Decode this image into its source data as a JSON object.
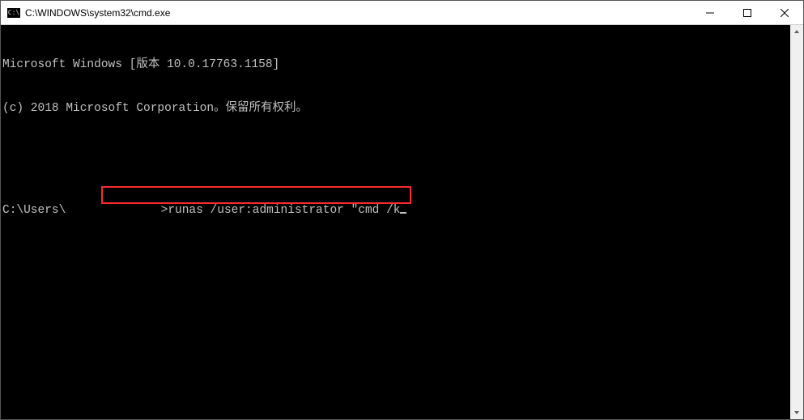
{
  "titlebar": {
    "icon_label": "C:\\",
    "title": "C:\\WINDOWS\\system32\\cmd.exe"
  },
  "terminal": {
    "line1": "Microsoft Windows [版本 10.0.17763.1158]",
    "line2": "(c) 2018 Microsoft Corporation。保留所有权利。",
    "prompt_prefix": "C:\\Users\\",
    "highlighted_command": ">runas /user:administrator \"cmd /k"
  },
  "colors": {
    "highlight_border": "#ff2a2a",
    "terminal_fg": "#c0c0c0",
    "terminal_bg": "#000000"
  }
}
